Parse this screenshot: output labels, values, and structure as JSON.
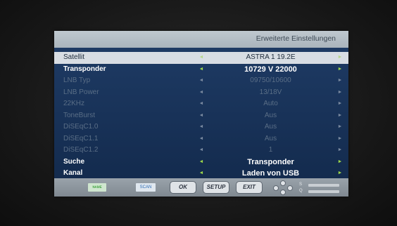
{
  "menu": {
    "title": "Erweiterte Einstellungen",
    "rows": [
      {
        "label": "Satellit",
        "value": "ASTRA 1 19.2E",
        "state": "selected"
      },
      {
        "label": "Transponder",
        "value": "10729 V 22000",
        "state": "active"
      },
      {
        "label": "LNB Typ",
        "value": "09750/10600",
        "state": "dim"
      },
      {
        "label": "LNB Power",
        "value": "13/18V",
        "state": "dim"
      },
      {
        "label": "22KHz",
        "value": "Auto",
        "state": "dim"
      },
      {
        "label": "ToneBurst",
        "value": "Aus",
        "state": "dim"
      },
      {
        "label": "DiSEqC1.0",
        "value": "Aus",
        "state": "dim"
      },
      {
        "label": "DiSEqC1.1",
        "value": "Aus",
        "state": "dim"
      },
      {
        "label": "DiSEqC1.2",
        "value": "1",
        "state": "dim"
      },
      {
        "label": "Suche",
        "value": "Transponder",
        "state": "active"
      },
      {
        "label": "Kanal",
        "value": "Laden von USB",
        "state": "active"
      }
    ]
  },
  "footer": {
    "badge_green": "ɴᴀᴍᴇ",
    "badge_blue": "SCAN",
    "ok_label": "OK",
    "setup_label": "SETUP",
    "exit_label": "EXIT",
    "signal_label_s": "S",
    "signal_label_q": "Q"
  },
  "icons": {
    "arrow_left": "◄",
    "arrow_right": "►"
  },
  "colors": {
    "menu_bg": "#1f3c66",
    "header_bg": "#bfc8cf",
    "selected_row_bg": "#d8dde3",
    "arrow_active": "#9ed84a"
  }
}
